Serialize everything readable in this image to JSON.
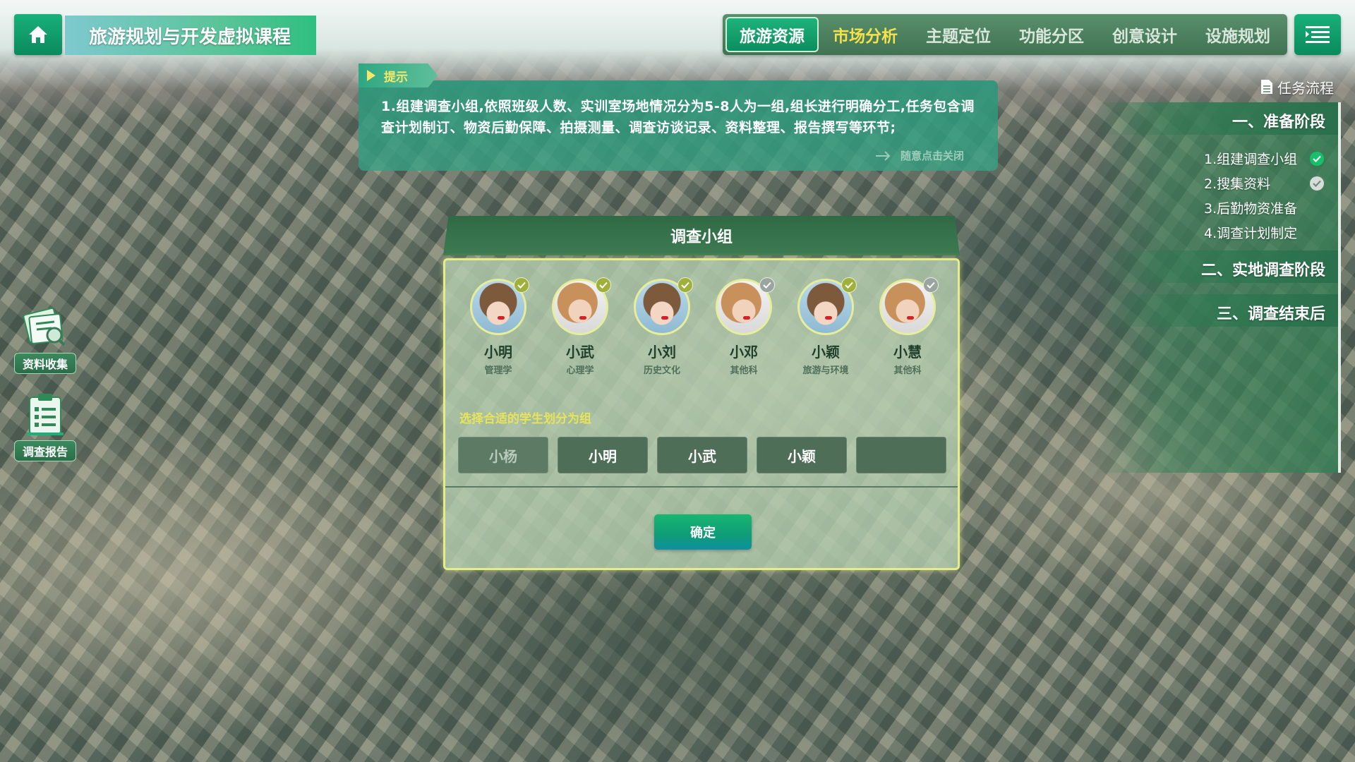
{
  "header": {
    "title": "旅游规划与开发虚拟课程",
    "nav_tabs": [
      {
        "label": "旅游资源",
        "active": true
      },
      {
        "label": "市场分析",
        "highlight": true
      },
      {
        "label": "主题定位"
      },
      {
        "label": "功能分区"
      },
      {
        "label": "创意设计"
      },
      {
        "label": "设施规划"
      }
    ]
  },
  "hint": {
    "tag": "提示",
    "text": "1.组建调查小组,依照班级人数、实训室场地情况分为5-8人为一组,组长进行明确分工,任务包含调查计划制订、物资后勤保障、拍摄测量、调查访谈记录、资料整理、报告撰写等环节;",
    "close_label": "随意点击关闭"
  },
  "tools": [
    {
      "label": "资料收集",
      "icon": "notebook-magnifier-icon"
    },
    {
      "label": "调查报告",
      "icon": "clipboard-list-icon"
    }
  ],
  "task_flow": {
    "title": "任务流程",
    "stages": [
      {
        "label": "一、准备阶段",
        "steps": [
          {
            "label": "1.组建调查小组",
            "status": "done-green"
          },
          {
            "label": "2.搜集资料",
            "status": "done-grey"
          },
          {
            "label": "3.后勤物资准备",
            "status": ""
          },
          {
            "label": "4.调查计划制定",
            "status": ""
          }
        ]
      },
      {
        "label": "二、实地调查阶段"
      },
      {
        "label": "三、调查结束后"
      }
    ]
  },
  "modal": {
    "title": "调查小组",
    "students": [
      {
        "name": "小明",
        "major": "管理学",
        "checked": "gold"
      },
      {
        "name": "小武",
        "major": "心理学",
        "checked": "gold"
      },
      {
        "name": "小刘",
        "major": "历史文化",
        "checked": "gold"
      },
      {
        "name": "小邓",
        "major": "其他科",
        "checked": "silver"
      },
      {
        "name": "小颖",
        "major": "旅游与环境",
        "checked": "gold"
      },
      {
        "name": "小慧",
        "major": "其他科",
        "checked": "silver"
      }
    ],
    "select_label": "选择合适的学生划分为组",
    "slots": [
      "小杨",
      "小明",
      "小武",
      "小颖",
      ""
    ],
    "confirm_label": "确定"
  },
  "colors": {
    "accent_green": "#0a8a5c",
    "highlight_yellow": "#f5e24a",
    "modal_border": "#e4ec8c"
  }
}
